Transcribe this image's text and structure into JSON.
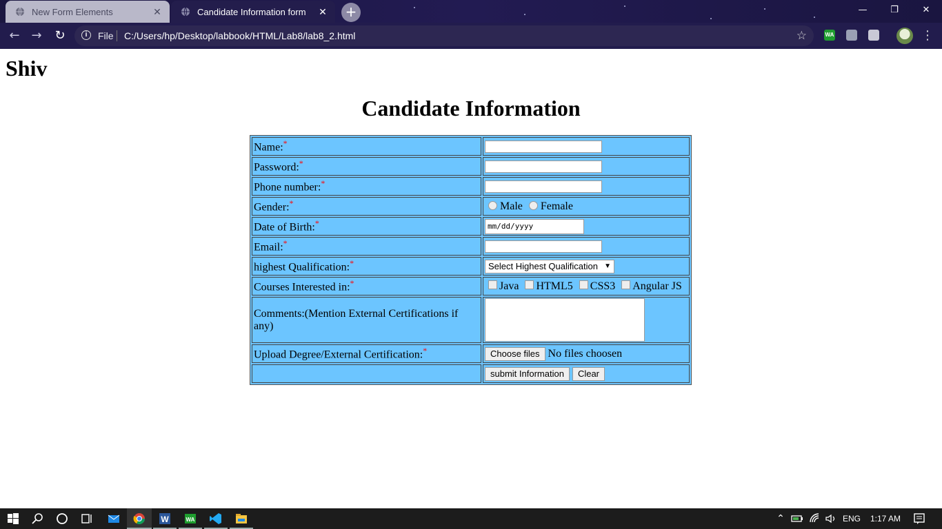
{
  "browser": {
    "tabs": [
      {
        "title": "New Form Elements",
        "active": false
      },
      {
        "title": "Candidate Information form",
        "active": true
      }
    ],
    "new_tab_label": "+",
    "address": {
      "scheme_label": "File",
      "url": "C:/Users/hp/Desktop/labbook/HTML/Lab8/lab8_2.html"
    },
    "window_controls": {
      "minimize": "—",
      "restore": "❐",
      "close": "✕"
    },
    "extensions": [
      {
        "name": "wa-extension-icon",
        "label": "WA",
        "color": "#1f9d2f"
      },
      {
        "name": "extension-icon-2",
        "label": "",
        "color": "#9aa0b4"
      },
      {
        "name": "extension-icon-3",
        "label": "",
        "color": "#c9c9d6"
      }
    ]
  },
  "page": {
    "author_heading": "Shiv",
    "title": "Candidate Information",
    "form": {
      "required_mark": "*",
      "name_label": "Name:",
      "password_label": "Password:",
      "phone_label": "Phone number:",
      "gender_label": "Gender:",
      "gender_options": [
        "Male",
        "Female"
      ],
      "dob_label": "Date of Birth:",
      "dob_placeholder": "mm/dd/yyyy",
      "email_label": "Email:",
      "qualification_label": "highest Qualification:",
      "qualification_selected": "Select Highest Qualification",
      "courses_label": "Courses Interested in:",
      "courses": [
        "Java",
        "HTML5",
        "CSS3",
        "Angular JS"
      ],
      "comments_label": "Comments:(Mention External Certifications if any)",
      "upload_label": "Upload Degree/External Certification:",
      "choose_files_button": "Choose files",
      "no_files_text": "No files choosen",
      "submit_button": "submit Information",
      "clear_button": "Clear"
    }
  },
  "taskbar": {
    "language": "ENG",
    "time": "1:17 AM"
  }
}
